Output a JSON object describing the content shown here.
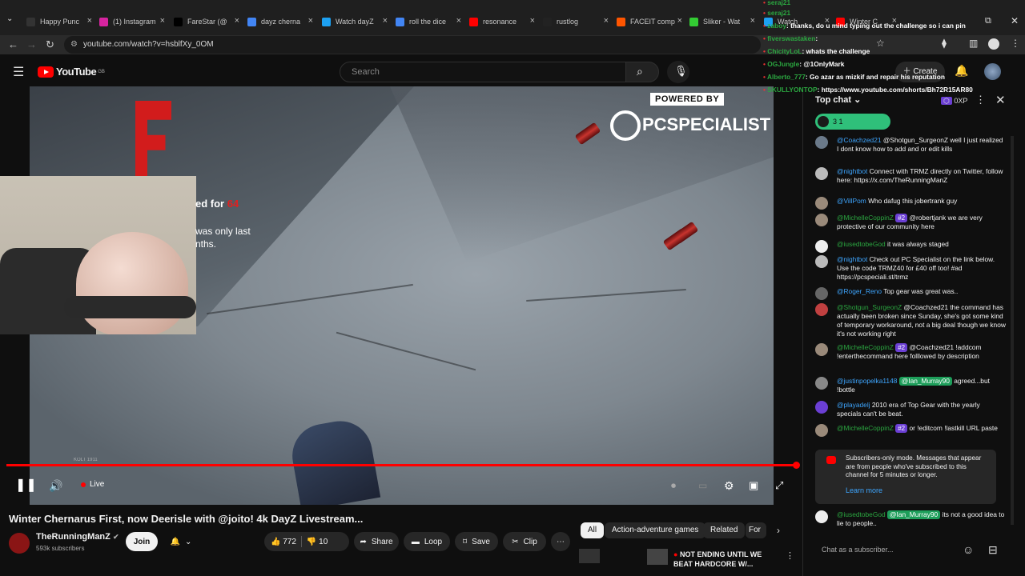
{
  "browser": {
    "tabs": [
      {
        "label": "Happy Punc",
        "color": "#333333"
      },
      {
        "label": "(1) Instagram",
        "color": "#d6249f"
      },
      {
        "label": "FareStar (@",
        "color": "#000000"
      },
      {
        "label": "dayz cherna",
        "color": "#4285f4"
      },
      {
        "label": "Watch dayZ",
        "color": "#1da1f2"
      },
      {
        "label": "roll the dice",
        "color": "#4285f4"
      },
      {
        "label": "resonance",
        "color": "#ff0000"
      },
      {
        "label": "rustlog",
        "color": "#222222"
      },
      {
        "label": "FACEIT comp",
        "color": "#ff5500"
      },
      {
        "label": "Sliker - Wat",
        "color": "#33cc33"
      },
      {
        "label": "Watch",
        "color": "#1da1f2"
      },
      {
        "label": "Winter C",
        "color": "#ff0000"
      }
    ],
    "url": "youtube.com/watch?v=hsblfXy_0OM"
  },
  "masthead": {
    "logo": "YouTube",
    "logo_region": "GB",
    "search_placeholder": "Search",
    "create_label": "Create"
  },
  "video": {
    "sponsor_top": "POWERED BY",
    "sponsor_name": "PCSPECIALIST",
    "overlay_line1": "ed for",
    "overlay_num": "64",
    "overlay_line2": "was only last",
    "overlay_line3": "nths.",
    "hud_text": "KOLT 1911",
    "live_label": "Live"
  },
  "info": {
    "title": "Winter Chernarus First, now Deerisle with @joito! 4k DayZ Livestream...",
    "channel": "TheRunningManZ",
    "subscribers": "593k subscribers",
    "join": "Join",
    "likes": "772",
    "dislikes": "10",
    "share": "Share",
    "loop": "Loop",
    "save": "Save",
    "clip": "Clip"
  },
  "chips": [
    "All",
    "Action-adventure games",
    "Related",
    "For"
  ],
  "recommended_title_line1": "NOT ENDING UNTIL WE",
  "recommended_title_line2": "BEAT HARDCORE W/...",
  "overlay_chat": [
    {
      "name": "seraj21",
      "text": ""
    },
    {
      "name": "seraj21",
      "text": ""
    },
    {
      "name": "zaboy",
      "text": ": thanks, do u mind typing out the challenge so i can pin"
    },
    {
      "name": "fiverswastaken",
      "text": ":"
    },
    {
      "name": "ChicityLoL",
      "text": ": whats the challenge"
    },
    {
      "name": "OGJungle",
      "text": ": @1OnlyMark"
    },
    {
      "name": "Alberto_777",
      "text": ": Go azar as mizkif and repair his reputation"
    },
    {
      "name": "SKULLYONTOP",
      "text": ": https://www.youtube.com/shorts/Bh72R15AR80"
    }
  ],
  "chat": {
    "header": "Top chat",
    "xp": "0XP",
    "pill": "3  1",
    "messages": [
      {
        "author": "@Coachzed21",
        "text": "@Shotgun_SurgeonZ well I just realized I dont know how to add and or edit kills",
        "badge": "",
        "color": "#6b7a8a"
      },
      {
        "author": "@nightbot",
        "text": "Connect with TRMZ directly on Twitter, follow here: https://x.com/TheRunningManZ",
        "badge": "",
        "color": "#bbbbbb"
      },
      {
        "author": "@VillPom",
        "text": "Who dafug this jobertrank guy",
        "badge": "",
        "color": "#9a8a7a"
      },
      {
        "author": "@MichelleCoppinZ",
        "text": "@robertjank we are very protective of our community here",
        "badge": "#2",
        "color": "#9a8a7a"
      },
      {
        "author": "@iusedtobeGod",
        "text": "it was always staged",
        "badge": "",
        "color": "#eeeeee"
      },
      {
        "author": "@nightbot",
        "text": "Check out PC Specialist on the link below. Use the code TRMZ40 for £40 off too! #ad https://pcspeciali.st/trmz",
        "badge": "",
        "color": "#bbbbbb"
      },
      {
        "author": "@Roger_Reno",
        "text": "Top gear was great was..",
        "badge": "",
        "color": "#666666"
      },
      {
        "author": "@Shotgun_SurgeonZ",
        "text": "@Coachzed21 the command has actually been broken since Sunday, she's got some kind of temporary workaround, not a big deal though we know it's not working right",
        "badge": "",
        "color": "#c04040"
      },
      {
        "author": "@MichelleCoppinZ",
        "text": "@Coachzed21 !addcom !enterthecommand here folllowed by description",
        "badge": "#2",
        "color": "#9a8a7a"
      },
      {
        "author": "@justinpopelka1148",
        "text": "agreed...but !bottle",
        "badge": "",
        "mention": "@Ian_Murray90",
        "color": "#888888"
      },
      {
        "author": "@playadelj",
        "text": "2010 era of Top Gear with the yearly specials can't be beat.",
        "badge": "",
        "color": "#6b3fd4"
      },
      {
        "author": "@MichelleCoppinZ",
        "text": "or !editcom !lastkill URL paste",
        "badge": "#2",
        "color": "#9a8a7a"
      },
      {
        "author": "@iusedtobeGod",
        "text": "its not a good idea to lie to people..",
        "badge": "",
        "mention": "@Ian_Murray90",
        "color": "#eeeeee"
      }
    ],
    "subscribers_notice": "Subscribers-only mode. Messages that appear are from people who've subscribed to this channel for 5 minutes or longer.",
    "learn_more": "Learn more",
    "input_placeholder": "Chat as a subscriber..."
  }
}
